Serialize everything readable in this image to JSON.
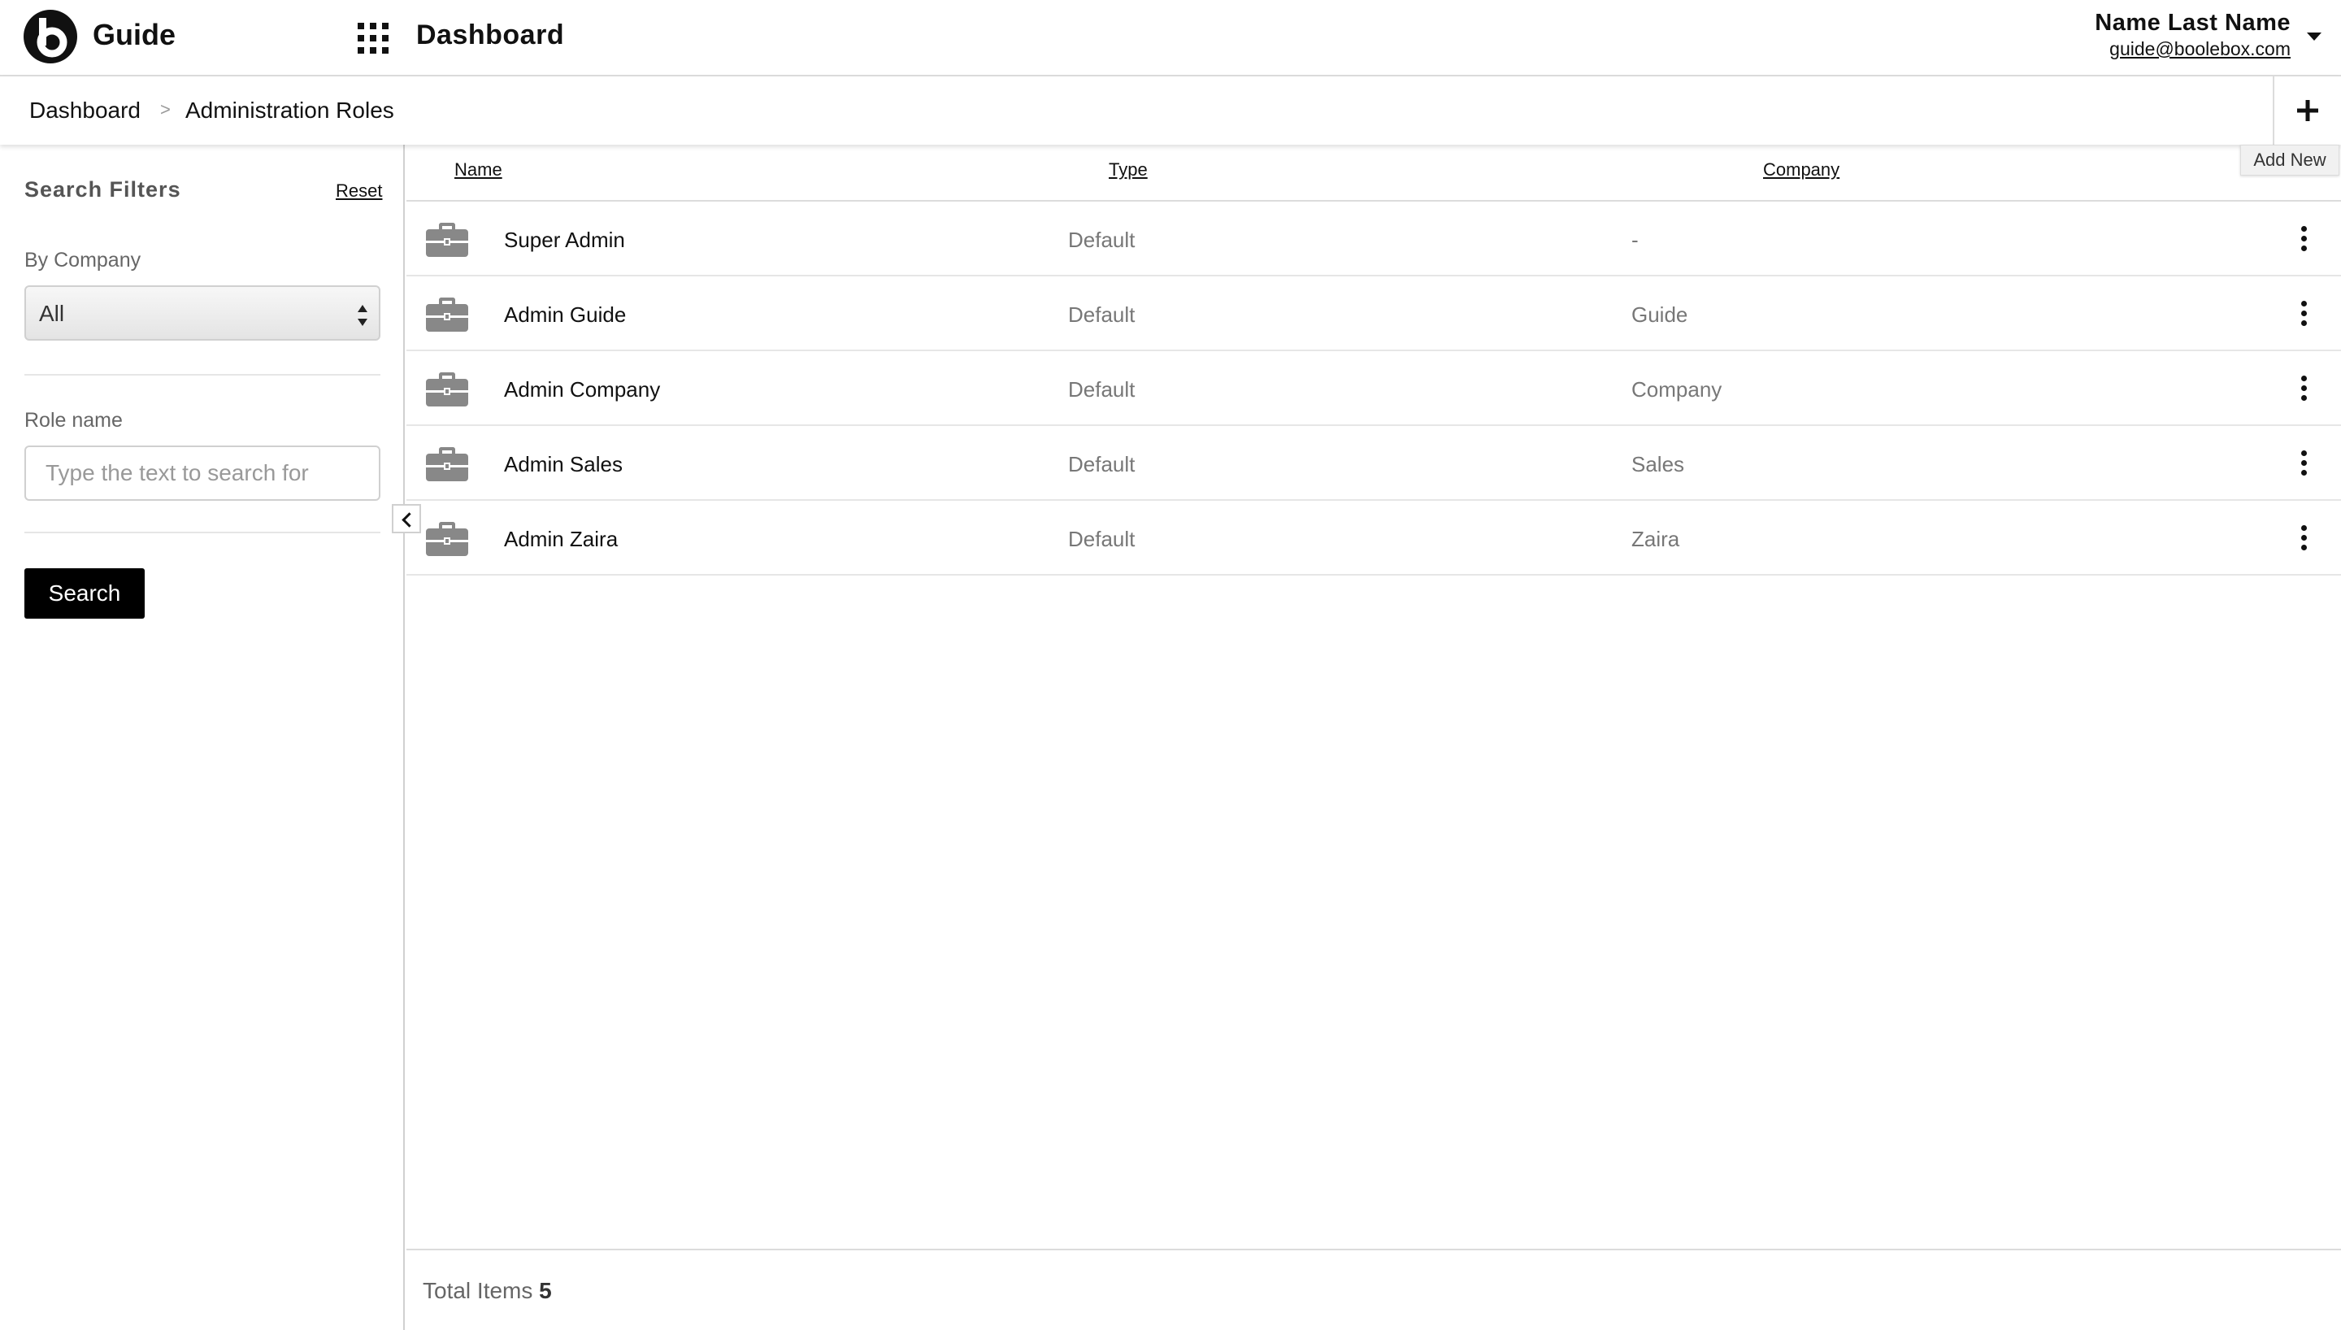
{
  "header": {
    "app_name": "Guide",
    "page_title": "Dashboard",
    "user_name": "Name Last Name",
    "user_email": "guide@boolebox.com"
  },
  "breadcrumb": {
    "items": [
      "Dashboard",
      "Administration Roles"
    ],
    "separator": ">"
  },
  "toolbar": {
    "add_new_tooltip": "Add New"
  },
  "filters": {
    "title": "Search Filters",
    "reset_label": "Reset",
    "by_company_label": "By Company",
    "by_company_value": "All",
    "role_name_label": "Role name",
    "role_name_placeholder": "Type the text to search for",
    "role_name_value": "",
    "search_button_label": "Search"
  },
  "table": {
    "columns": [
      "Name",
      "Type",
      "Company"
    ],
    "rows": [
      {
        "name": "Super Admin",
        "type": "Default",
        "company": "-"
      },
      {
        "name": "Admin Guide",
        "type": "Default",
        "company": "Guide"
      },
      {
        "name": "Admin Company",
        "type": "Default",
        "company": "Company"
      },
      {
        "name": "Admin Sales",
        "type": "Default",
        "company": "Sales"
      },
      {
        "name": "Admin Zaira",
        "type": "Default",
        "company": "Zaira"
      }
    ],
    "row_icon": "briefcase-icon",
    "row_menu_icon": "more-vertical-icon"
  },
  "footer": {
    "total_label": "Total Items",
    "total_value": "5"
  },
  "colors": {
    "accent": "#000000",
    "muted_text": "#777777",
    "icon_gray": "#888888"
  }
}
